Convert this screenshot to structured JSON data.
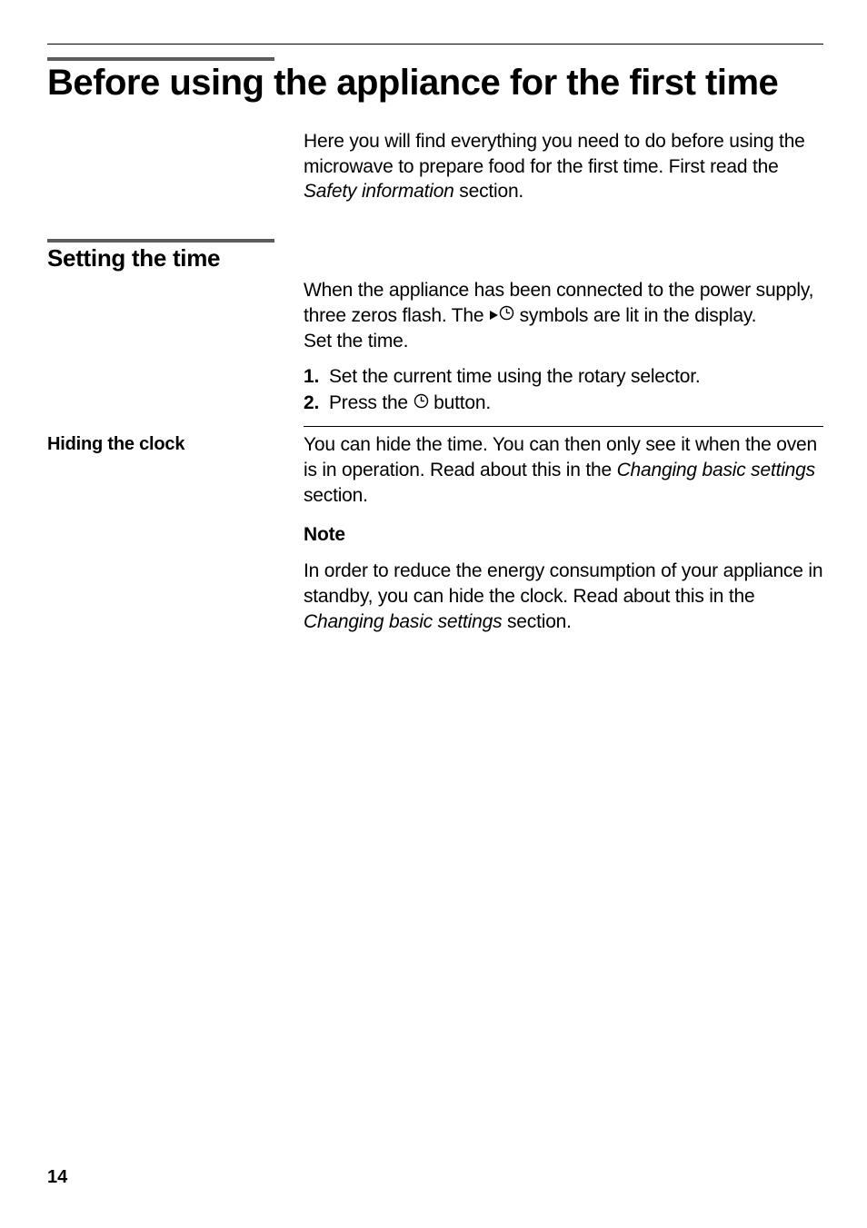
{
  "page": {
    "number": "14"
  },
  "title": "Before using the appliance for the first time",
  "intro": {
    "line1": "Here you will find everything you need to do before using the microwave to prepare food for the first time. First read the ",
    "line2_italic": "Safety information",
    "line3": " section."
  },
  "section1": {
    "heading": "Setting the time",
    "para1a": "When the appliance has been connected to the power supply, three zeros flash. The ",
    "para1b": " symbols are lit in the display.",
    "para2": "Set the time.",
    "steps": [
      {
        "num": "1.",
        "text": "Set the current time using the rotary selector."
      },
      {
        "num": "2.",
        "textA": "Press the ",
        "textB": " button."
      }
    ]
  },
  "section2": {
    "left": "Hiding the clock",
    "para1a": "You can hide the time. You can then only see it when the oven is in operation. Read about this in the ",
    "para1b_italic": "Changing basic settings",
    "para1c": " section."
  },
  "note": {
    "heading": "Note",
    "textA": "In order to reduce the energy consumption of your appliance in standby, you can hide the clock. Read about this in the ",
    "textB_italic": "Changing basic settings",
    "textC": " section."
  },
  "icons": {
    "triangle_clock": "triangle-right-clock-icon",
    "clock": "clock-icon"
  }
}
